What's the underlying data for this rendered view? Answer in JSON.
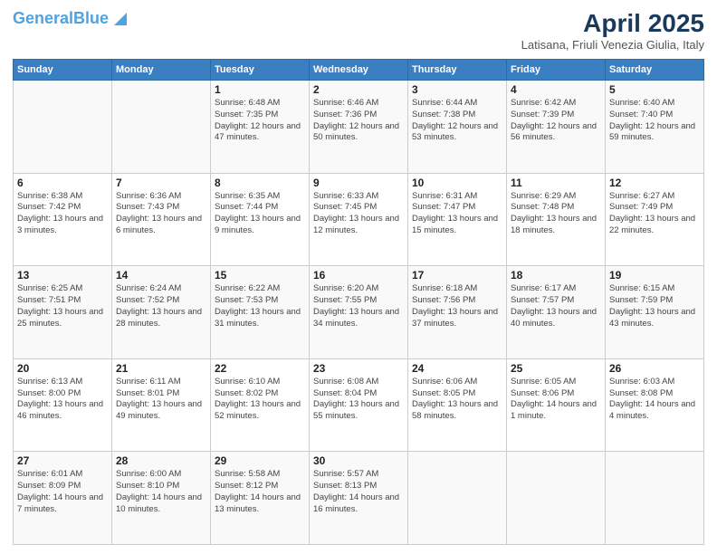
{
  "header": {
    "logo_general": "General",
    "logo_blue": "Blue",
    "main_title": "April 2025",
    "subtitle": "Latisana, Friuli Venezia Giulia, Italy"
  },
  "days_of_week": [
    "Sunday",
    "Monday",
    "Tuesday",
    "Wednesday",
    "Thursday",
    "Friday",
    "Saturday"
  ],
  "weeks": [
    [
      {
        "num": "",
        "detail": ""
      },
      {
        "num": "",
        "detail": ""
      },
      {
        "num": "1",
        "detail": "Sunrise: 6:48 AM\nSunset: 7:35 PM\nDaylight: 12 hours and 47 minutes."
      },
      {
        "num": "2",
        "detail": "Sunrise: 6:46 AM\nSunset: 7:36 PM\nDaylight: 12 hours and 50 minutes."
      },
      {
        "num": "3",
        "detail": "Sunrise: 6:44 AM\nSunset: 7:38 PM\nDaylight: 12 hours and 53 minutes."
      },
      {
        "num": "4",
        "detail": "Sunrise: 6:42 AM\nSunset: 7:39 PM\nDaylight: 12 hours and 56 minutes."
      },
      {
        "num": "5",
        "detail": "Sunrise: 6:40 AM\nSunset: 7:40 PM\nDaylight: 12 hours and 59 minutes."
      }
    ],
    [
      {
        "num": "6",
        "detail": "Sunrise: 6:38 AM\nSunset: 7:42 PM\nDaylight: 13 hours and 3 minutes."
      },
      {
        "num": "7",
        "detail": "Sunrise: 6:36 AM\nSunset: 7:43 PM\nDaylight: 13 hours and 6 minutes."
      },
      {
        "num": "8",
        "detail": "Sunrise: 6:35 AM\nSunset: 7:44 PM\nDaylight: 13 hours and 9 minutes."
      },
      {
        "num": "9",
        "detail": "Sunrise: 6:33 AM\nSunset: 7:45 PM\nDaylight: 13 hours and 12 minutes."
      },
      {
        "num": "10",
        "detail": "Sunrise: 6:31 AM\nSunset: 7:47 PM\nDaylight: 13 hours and 15 minutes."
      },
      {
        "num": "11",
        "detail": "Sunrise: 6:29 AM\nSunset: 7:48 PM\nDaylight: 13 hours and 18 minutes."
      },
      {
        "num": "12",
        "detail": "Sunrise: 6:27 AM\nSunset: 7:49 PM\nDaylight: 13 hours and 22 minutes."
      }
    ],
    [
      {
        "num": "13",
        "detail": "Sunrise: 6:25 AM\nSunset: 7:51 PM\nDaylight: 13 hours and 25 minutes."
      },
      {
        "num": "14",
        "detail": "Sunrise: 6:24 AM\nSunset: 7:52 PM\nDaylight: 13 hours and 28 minutes."
      },
      {
        "num": "15",
        "detail": "Sunrise: 6:22 AM\nSunset: 7:53 PM\nDaylight: 13 hours and 31 minutes."
      },
      {
        "num": "16",
        "detail": "Sunrise: 6:20 AM\nSunset: 7:55 PM\nDaylight: 13 hours and 34 minutes."
      },
      {
        "num": "17",
        "detail": "Sunrise: 6:18 AM\nSunset: 7:56 PM\nDaylight: 13 hours and 37 minutes."
      },
      {
        "num": "18",
        "detail": "Sunrise: 6:17 AM\nSunset: 7:57 PM\nDaylight: 13 hours and 40 minutes."
      },
      {
        "num": "19",
        "detail": "Sunrise: 6:15 AM\nSunset: 7:59 PM\nDaylight: 13 hours and 43 minutes."
      }
    ],
    [
      {
        "num": "20",
        "detail": "Sunrise: 6:13 AM\nSunset: 8:00 PM\nDaylight: 13 hours and 46 minutes."
      },
      {
        "num": "21",
        "detail": "Sunrise: 6:11 AM\nSunset: 8:01 PM\nDaylight: 13 hours and 49 minutes."
      },
      {
        "num": "22",
        "detail": "Sunrise: 6:10 AM\nSunset: 8:02 PM\nDaylight: 13 hours and 52 minutes."
      },
      {
        "num": "23",
        "detail": "Sunrise: 6:08 AM\nSunset: 8:04 PM\nDaylight: 13 hours and 55 minutes."
      },
      {
        "num": "24",
        "detail": "Sunrise: 6:06 AM\nSunset: 8:05 PM\nDaylight: 13 hours and 58 minutes."
      },
      {
        "num": "25",
        "detail": "Sunrise: 6:05 AM\nSunset: 8:06 PM\nDaylight: 14 hours and 1 minute."
      },
      {
        "num": "26",
        "detail": "Sunrise: 6:03 AM\nSunset: 8:08 PM\nDaylight: 14 hours and 4 minutes."
      }
    ],
    [
      {
        "num": "27",
        "detail": "Sunrise: 6:01 AM\nSunset: 8:09 PM\nDaylight: 14 hours and 7 minutes."
      },
      {
        "num": "28",
        "detail": "Sunrise: 6:00 AM\nSunset: 8:10 PM\nDaylight: 14 hours and 10 minutes."
      },
      {
        "num": "29",
        "detail": "Sunrise: 5:58 AM\nSunset: 8:12 PM\nDaylight: 14 hours and 13 minutes."
      },
      {
        "num": "30",
        "detail": "Sunrise: 5:57 AM\nSunset: 8:13 PM\nDaylight: 14 hours and 16 minutes."
      },
      {
        "num": "",
        "detail": ""
      },
      {
        "num": "",
        "detail": ""
      },
      {
        "num": "",
        "detail": ""
      }
    ]
  ]
}
